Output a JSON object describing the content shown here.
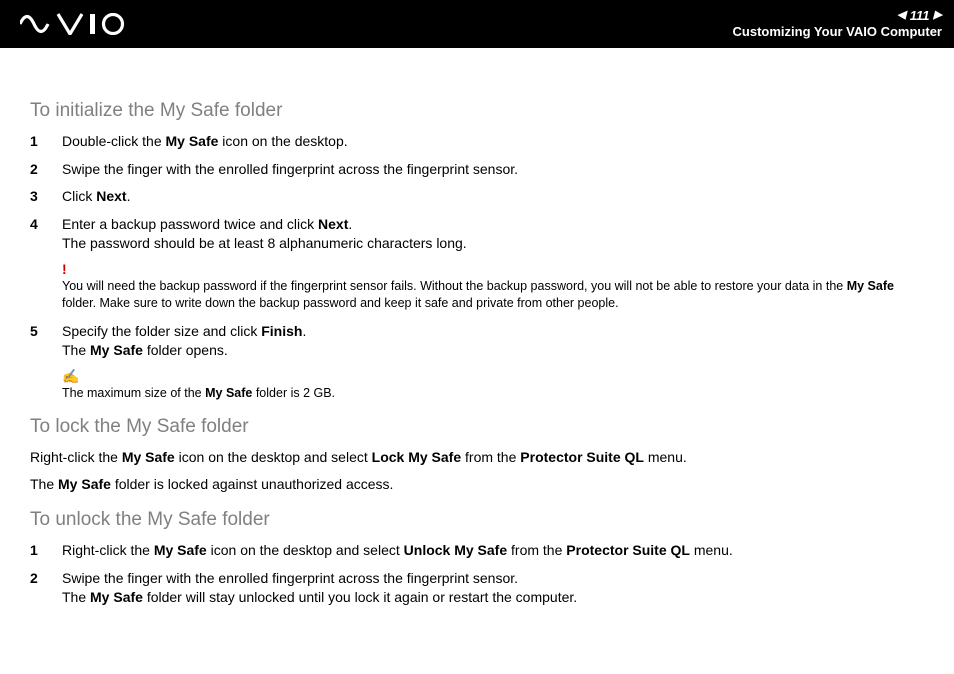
{
  "header": {
    "page_number": "111",
    "subtitle": "Customizing Your VAIO Computer"
  },
  "section1": {
    "title": "To initialize the My Safe folder",
    "step1_a": "Double-click the ",
    "step1_b": "My Safe",
    "step1_c": " icon on the desktop.",
    "step2": "Swipe the finger with the enrolled fingerprint across the fingerprint sensor.",
    "step3_a": "Click ",
    "step3_b": "Next",
    "step3_c": ".",
    "step4_a": "Enter a backup password twice and click ",
    "step4_b": "Next",
    "step4_c": ".",
    "step4_line2": "The password should be at least 8 alphanumeric characters long.",
    "warn_a": "You will need the backup password if the fingerprint sensor fails. Without the backup password, you will not be able to restore your data in the ",
    "warn_b": "My Safe",
    "warn_c": " folder. Make sure to write down the backup password and keep it safe and private from other people.",
    "step5_a": "Specify the folder size and click ",
    "step5_b": "Finish",
    "step5_c": ".",
    "step5_line2a": "The ",
    "step5_line2b": "My Safe",
    "step5_line2c": " folder opens.",
    "tip_a": "The maximum size of the ",
    "tip_b": "My Safe",
    "tip_c": " folder is 2 GB."
  },
  "section2": {
    "title": "To lock the My Safe folder",
    "p1_a": "Right-click the ",
    "p1_b": "My Safe",
    "p1_c": " icon on the desktop and select ",
    "p1_d": "Lock My Safe",
    "p1_e": " from the ",
    "p1_f": "Protector Suite QL",
    "p1_g": " menu.",
    "p2_a": "The ",
    "p2_b": "My Safe",
    "p2_c": " folder is locked against unauthorized access."
  },
  "section3": {
    "title": "To unlock the My Safe folder",
    "s1_a": "Right-click the ",
    "s1_b": "My Safe",
    "s1_c": " icon on the desktop and select ",
    "s1_d": "Unlock My Safe",
    "s1_e": " from the ",
    "s1_f": "Protector Suite QL",
    "s1_g": " menu.",
    "s2_l1": "Swipe the finger with the enrolled fingerprint across the fingerprint sensor.",
    "s2_l2a": "The ",
    "s2_l2b": "My Safe",
    "s2_l2c": " folder will stay unlocked until you lock it again or restart the computer."
  },
  "nums": {
    "n1": "1",
    "n2": "2",
    "n3": "3",
    "n4": "4",
    "n5": "5"
  },
  "marks": {
    "bang": "!",
    "pencil": "✍"
  }
}
